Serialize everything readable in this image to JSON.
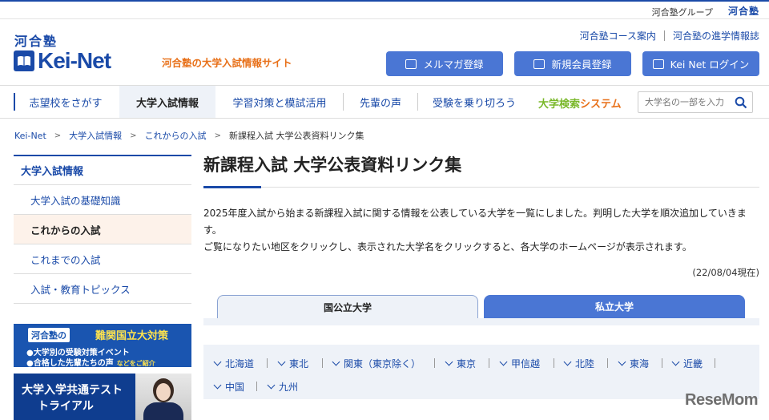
{
  "topbar": {
    "group_label": "河合塾グループ",
    "group_logo": "河合塾"
  },
  "header": {
    "logo_kawai": "河合塾",
    "logo_text": "Kei-Net",
    "tagline": "河合塾の大学入試情報サイト",
    "links": [
      "河合塾コース案内",
      "河合塾の進学情報誌"
    ],
    "buttons": {
      "mailmag": "メルマガ登録",
      "register": "新規会員登録",
      "login": "Kei Net ログイン"
    }
  },
  "nav": {
    "items": [
      "志望校をさがす",
      "大学入試情報",
      "学習対策と模試活用",
      "先輩の声",
      "受験を乗り切ろう"
    ],
    "search_title_a": "大学検索",
    "search_title_b": "システム",
    "search_placeholder": "大学名の一部を入力"
  },
  "breadcrumb": [
    "Kei-Net",
    "大学入試情報",
    "これからの入試",
    "新課程入試 大学公表資料リンク集"
  ],
  "sidebar": {
    "heading": "大学入試情報",
    "items": [
      "大学入試の基礎知識",
      "これからの入試",
      "これまでの入試",
      "入試・教育トピックス"
    ]
  },
  "banners": {
    "b1_tag": "河合塾の",
    "b1_title": "難関国立大対策",
    "b1_line1": "●大学別の受験対策イベント",
    "b1_line2": "●合格した先輩たちの声",
    "b1_small": "などをご紹介",
    "b2_line1": "大学入学共通テスト",
    "b2_line2": "トライアル"
  },
  "main": {
    "title": "新課程入試 大学公表資料リンク集",
    "desc1": "2025年度入試から始まる新課程入試に関する情報を公表している大学を一覧にしました。判明した大学を順次追加していきます。",
    "desc2": "ご覧になりたい地区をクリックし、表示された大学名をクリックすると、各大学のホームページが表示されます。",
    "date": "(22/08/04現在)",
    "tabs": [
      "国公立大学",
      "私立大学"
    ],
    "regions": [
      "北海道",
      "東北",
      "関東（東京除く）",
      "東京",
      "甲信越",
      "北陸",
      "東海",
      "近畿",
      "中国",
      "九州"
    ]
  },
  "watermark": "ReseMom"
}
